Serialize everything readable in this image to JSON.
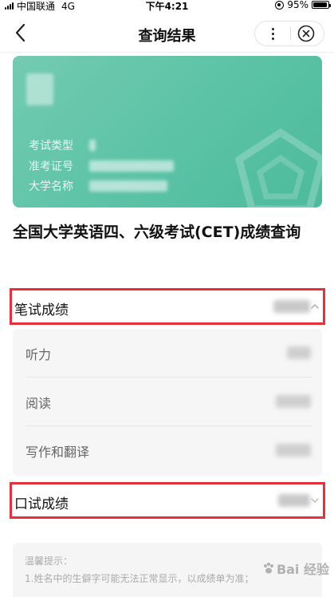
{
  "status_bar": {
    "carrier": "中国联通",
    "network": "4G",
    "time": "下午4:21",
    "battery": "95%",
    "battery_level": 0.95
  },
  "nav": {
    "title": "查询结果",
    "icons": [
      "back-icon",
      "more-icon",
      "close-icon"
    ]
  },
  "card": {
    "rows": [
      {
        "label": "考试类型"
      },
      {
        "label": "准考证号"
      },
      {
        "label": "大学名称"
      }
    ],
    "colors": {
      "start": "#73cbb0",
      "end": "#4dbb9c"
    }
  },
  "exam_title": "全国大学英语四、六级考试(CET)成绩查询",
  "written": {
    "label": "笔试成绩",
    "expanded": true
  },
  "subscores": [
    {
      "label": "听力"
    },
    {
      "label": "阅读"
    },
    {
      "label": "写作和翻译"
    }
  ],
  "oral": {
    "label": "口试成绩"
  },
  "tips": {
    "title": "温馨提示：",
    "line1": "1.姓名中的生僻字可能无法正常显示，以成绩单为准；"
  },
  "watermark": "Bai 经验",
  "highlight_color": "#e8303a"
}
